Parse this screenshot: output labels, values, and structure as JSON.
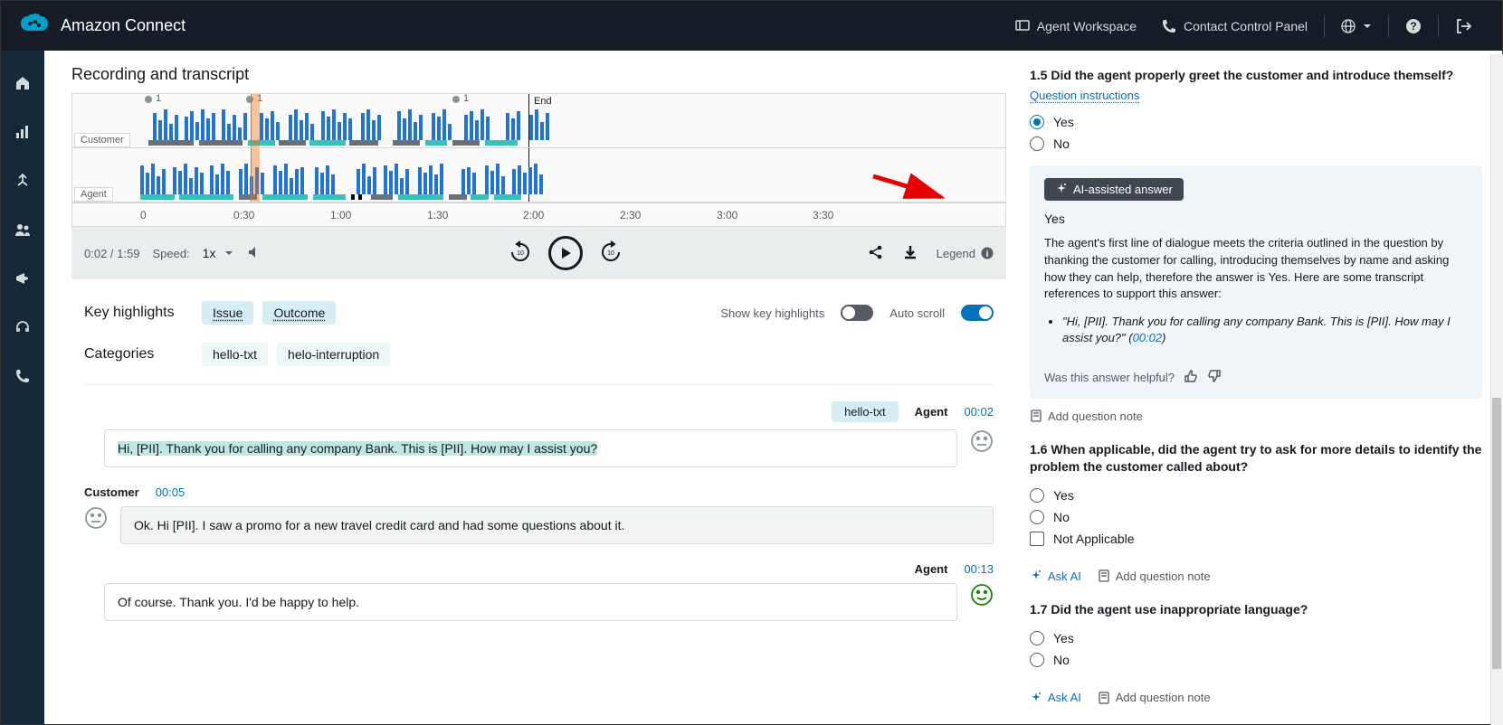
{
  "header": {
    "brand": "Amazon Connect",
    "agent_workspace": "Agent Workspace",
    "ccp": "Contact Control Panel"
  },
  "section": {
    "title": "Recording and transcript",
    "waveform": {
      "customer_label": "Customer",
      "agent_label": "Agent",
      "end_label": "End",
      "marker_1a": "1",
      "marker_1b": "1",
      "marker_1c": "1",
      "ticks": [
        "0",
        "0:30",
        "1:00",
        "1:30",
        "2:00",
        "2:30",
        "3:00",
        "3:30"
      ]
    },
    "player": {
      "position": "0:02 / 1:59",
      "speed_label": "Speed:",
      "speed_value": "1x",
      "legend": "Legend"
    }
  },
  "highlights": {
    "label": "Key highlights",
    "issue": "Issue",
    "outcome": "Outcome",
    "categories_label": "Categories",
    "cat1": "hello-txt",
    "cat2": "helo-interruption",
    "show_label": "Show key highlights",
    "autoscroll_label": "Auto scroll"
  },
  "transcript": {
    "t1": {
      "tag": "hello-txt",
      "role": "Agent",
      "time": "00:02",
      "text": "Hi, [PII]. Thank you for calling any company Bank. This is [PII]. How may I assist you?"
    },
    "t2": {
      "role": "Customer",
      "time": "00:05",
      "text": "Ok. Hi [PII]. I saw a promo for a new travel credit card and had some questions about it."
    },
    "t3": {
      "role": "Agent",
      "time": "00:13",
      "text": "Of course. Thank you. I'd be happy to help."
    }
  },
  "qa": {
    "q15": {
      "title": "1.5 Did the agent properly greet the customer and introduce themself?",
      "instructions": "Question instructions",
      "opt_yes": "Yes",
      "opt_no": "No",
      "ai_badge": "AI-assisted answer",
      "ai_answer": "Yes",
      "ai_explain": "The agent's first line of dialogue meets the criteria outlined in the question by thanking the customer for calling, introducing themselves by name and asking how they can help, therefore the answer is Yes. Here are some transcript references to support this answer:",
      "ai_quote": "\"Hi, [PII]. Thank you for calling any company Bank. This is [PII]. How may I assist you?\"",
      "ai_quote_ts": "00:02",
      "helpful": "Was this answer helpful?",
      "add_note": "Add question note"
    },
    "q16": {
      "title": "1.6 When applicable, did the agent try to ask for more details to identify the problem the customer called about?",
      "opt_yes": "Yes",
      "opt_no": "No",
      "opt_na": "Not Applicable",
      "ask_ai": "Ask AI",
      "add_note": "Add question note"
    },
    "q17": {
      "title": "1.7 Did the agent use inappropriate language?",
      "opt_yes": "Yes",
      "opt_no": "No",
      "ask_ai": "Ask AI",
      "add_note": "Add question note"
    }
  }
}
